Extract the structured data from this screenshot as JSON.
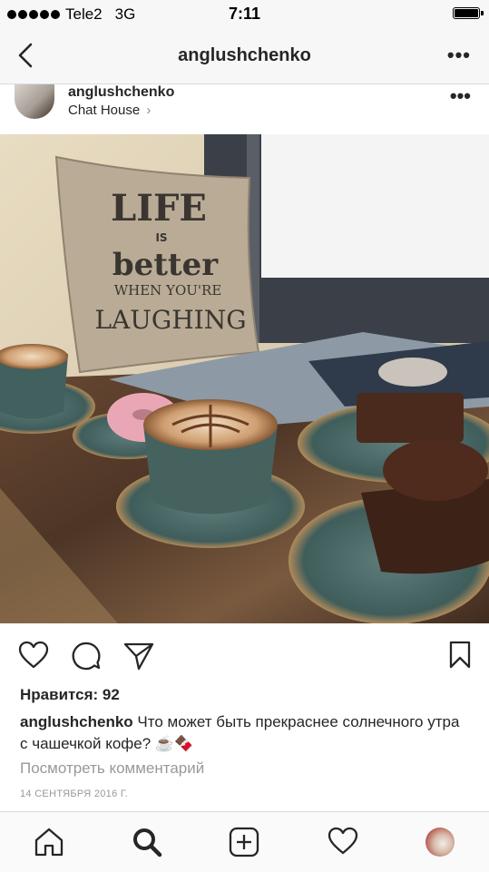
{
  "status_bar": {
    "carrier": "Tele2",
    "network": "3G",
    "time": "7:11"
  },
  "nav": {
    "title": "anglushchenko",
    "back_icon": "chevron-left-icon",
    "more_icon": "more-dots-icon"
  },
  "post": {
    "username": "anglushchenko",
    "location": "Chat House",
    "location_chevron": "›",
    "photo_text": {
      "line1": "LIFE",
      "line2": "IS",
      "line3": "better",
      "line4": "WHEN YOU'RE",
      "line5": "LAUGHING"
    },
    "likes_text": "Нравится: 92",
    "caption_user": "anglushchenko",
    "caption_text": " Что может быть прекраснее солнечного утра с чашечкой кофе? ☕🍫",
    "view_comments": "Посмотреть комментарий",
    "date": "14 СЕНТЯБРЯ 2016 Г."
  },
  "actions": [
    "heart-icon",
    "comment-icon",
    "share-icon",
    "bookmark-icon"
  ],
  "tabbar": [
    "home-icon",
    "search-icon",
    "add-icon",
    "activity-heart-icon",
    "profile-avatar"
  ],
  "colors": {
    "text": "#262626",
    "muted": "#999999",
    "border": "#dbdbdb",
    "bar_bg": "#f7f7f7"
  }
}
